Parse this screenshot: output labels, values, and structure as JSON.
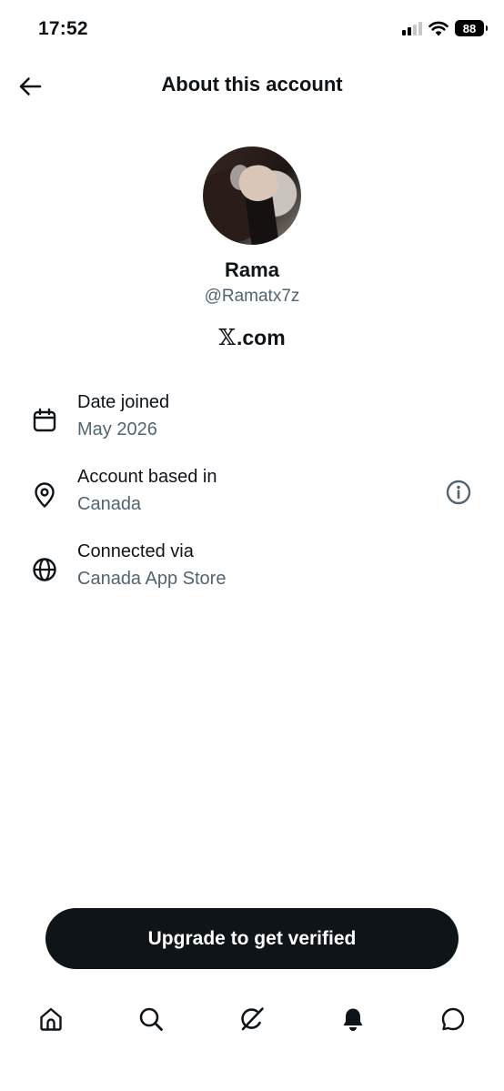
{
  "status_bar": {
    "time": "17:52",
    "battery": "88",
    "icons": [
      "signal-icon",
      "wifi-icon",
      "battery-icon"
    ]
  },
  "header": {
    "title": "About this account",
    "back_icon": "arrow-left-icon"
  },
  "profile": {
    "name": "Rama",
    "handle": "@Ramatx7z",
    "platform_mark": "𝕏",
    "platform_suffix": ".com"
  },
  "details": [
    {
      "icon": "calendar-icon",
      "label": "Date joined",
      "value": "May 2026"
    },
    {
      "icon": "location-pin-icon",
      "label": "Account based in",
      "value": "Canada",
      "action_icon": "info-icon"
    },
    {
      "icon": "globe-icon",
      "label": "Connected via",
      "value": "Canada App Store"
    }
  ],
  "cta": {
    "label": "Upgrade to get verified"
  },
  "bottom_nav": {
    "items": [
      {
        "icon": "home-icon"
      },
      {
        "icon": "search-icon"
      },
      {
        "icon": "grok-icon"
      },
      {
        "icon": "notifications-bell-icon",
        "active": true
      },
      {
        "icon": "messages-icon"
      }
    ]
  },
  "colors": {
    "text_primary": "#0f1419",
    "text_secondary": "#536471",
    "button_bg": "#0f1419",
    "background": "#ffffff"
  }
}
